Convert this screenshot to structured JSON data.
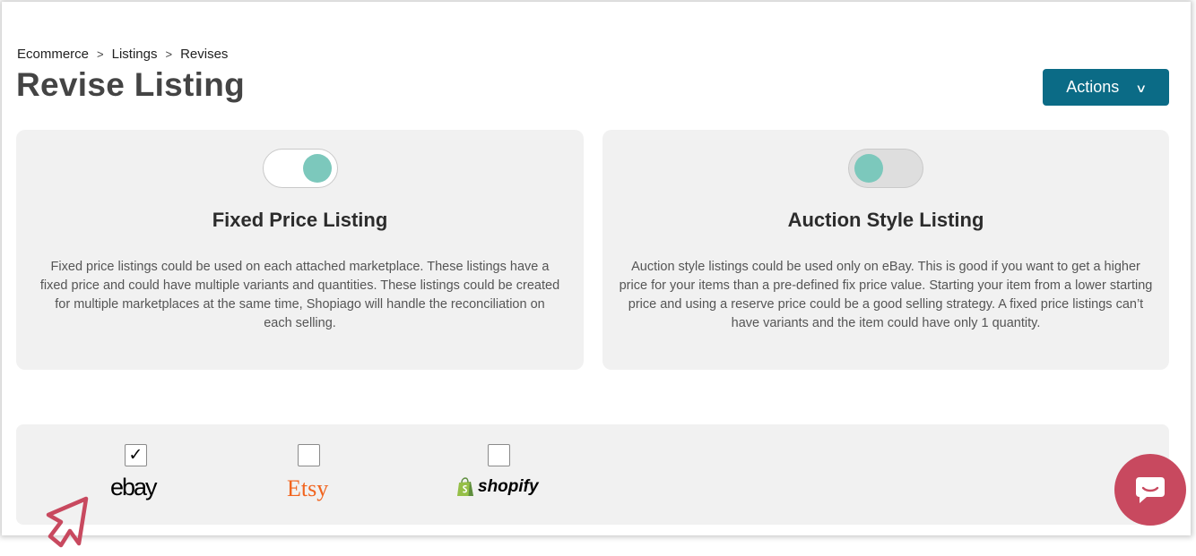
{
  "breadcrumb": {
    "items": [
      "Ecommerce",
      "Listings",
      "Revises"
    ],
    "separator": ">"
  },
  "header": {
    "title": "Revise Listing",
    "actions_label": "Actions",
    "actions_color": "#0b6b86"
  },
  "listing_types": [
    {
      "title": "Fixed Price Listing",
      "toggle_on": true,
      "description": "Fixed price listings could be used on each attached marketplace. These listings have a fixed price and could have multiple variants and quantities. These listings could be created for multiple marketplaces at the same time, Shopiago will handle the reconciliation on each selling."
    },
    {
      "title": "Auction Style Listing",
      "toggle_on": false,
      "description": "Auction style listings could be used only on eBay. This is good if you want to get a higher price for your items than a pre-defined fix price value. Starting your item from a lower starting price and using a reserve price could be a good selling strategy. A fixed price listings can’t have variants and the item could have only 1 quantity."
    }
  ],
  "marketplaces": [
    {
      "name": "ebay",
      "checked": true,
      "check_glyph": "✓"
    },
    {
      "name": "Etsy",
      "checked": false,
      "check_glyph": ""
    },
    {
      "name": "shopify",
      "checked": false,
      "check_glyph": ""
    }
  ],
  "colors": {
    "toggle_knob": "#7cc8bc",
    "etsy_brand": "#f1641e",
    "shopify_brand": "#95bf47",
    "chat_button": "#c8495f",
    "cursor": "#c8495f"
  },
  "icons": {
    "chat": "chat-bubble-icon",
    "cursor": "pointer-cursor-icon",
    "check": "checkmark-icon",
    "chevron": "chevron-down-icon"
  }
}
